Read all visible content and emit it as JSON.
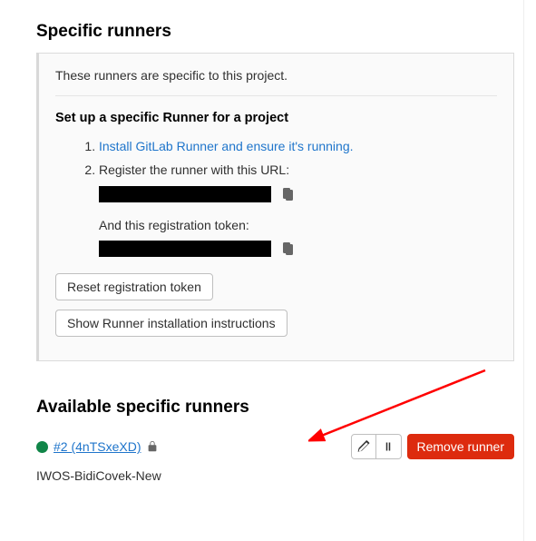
{
  "section": {
    "title": "Specific runners",
    "description": "These runners are specific to this project.",
    "setup_title": "Set up a specific Runner for a project",
    "step1_link": "Install GitLab Runner and ensure it's running.",
    "step2": "Register the runner with this URL:",
    "token_label": "And this registration token:",
    "reset_btn": "Reset registration token",
    "install_btn": "Show Runner installation instructions"
  },
  "available": {
    "title": "Available specific runners",
    "runner": {
      "id": "#2 (4nTSxeXD)",
      "description": "IWOS-BidiCovek-New"
    },
    "remove_btn": "Remove runner"
  }
}
